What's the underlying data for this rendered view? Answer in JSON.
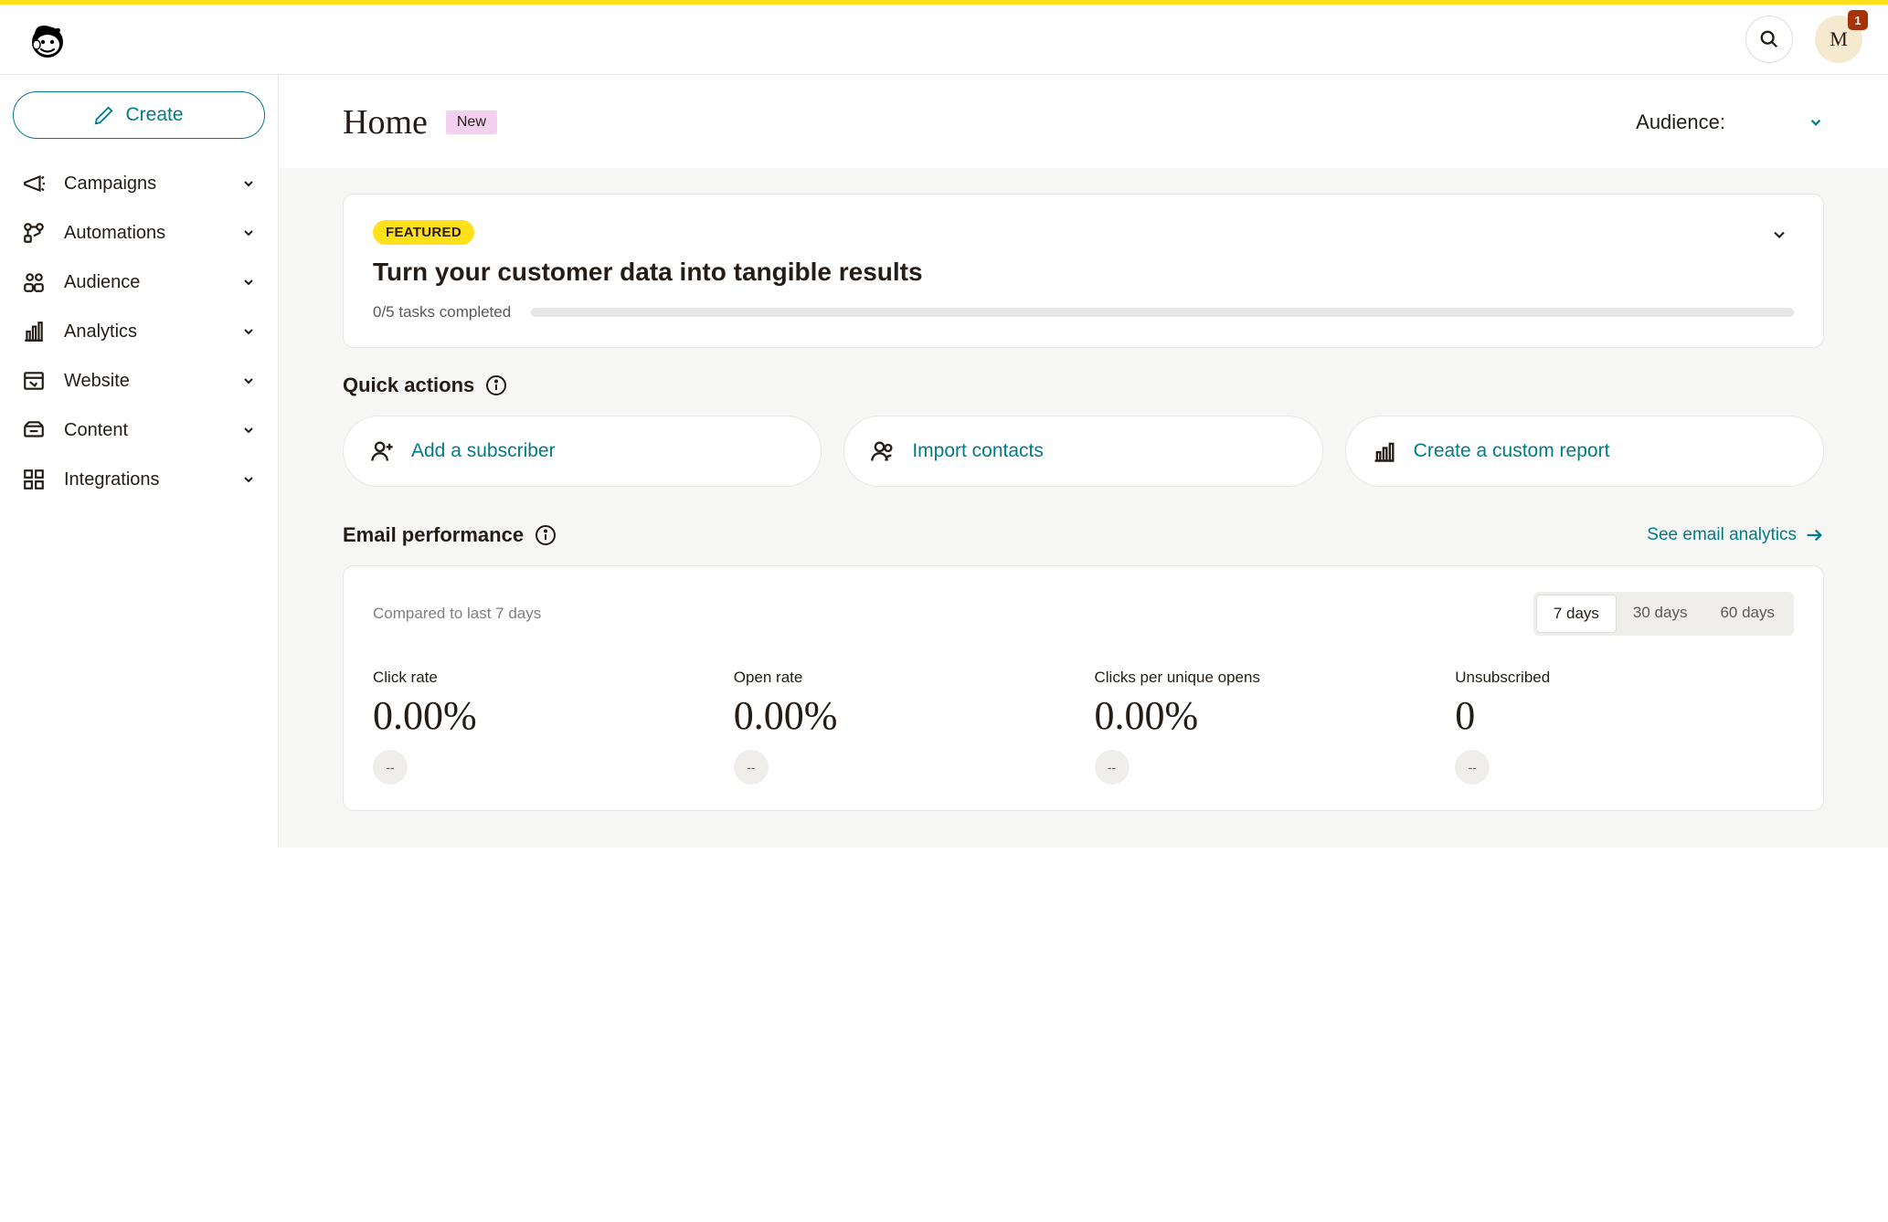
{
  "topbar": {
    "avatar_initial": "M",
    "notification_count": "1"
  },
  "sidebar": {
    "create_label": "Create",
    "items": [
      {
        "label": "Campaigns"
      },
      {
        "label": "Automations"
      },
      {
        "label": "Audience"
      },
      {
        "label": "Analytics"
      },
      {
        "label": "Website"
      },
      {
        "label": "Content"
      },
      {
        "label": "Integrations"
      }
    ]
  },
  "header": {
    "title": "Home",
    "new_badge": "New",
    "audience_label": "Audience:"
  },
  "featured": {
    "badge": "FEATURED",
    "title": "Turn your customer data into tangible results",
    "progress_text": "0/5 tasks completed"
  },
  "quick_actions": {
    "title": "Quick actions",
    "items": [
      {
        "label": "Add a subscriber"
      },
      {
        "label": "Import contacts"
      },
      {
        "label": "Create a custom report"
      }
    ]
  },
  "email_perf": {
    "title": "Email performance",
    "see_link": "See email analytics",
    "compared_text": "Compared to last 7 days",
    "range_tabs": [
      "7 days",
      "30 days",
      "60 days"
    ],
    "active_range": 0,
    "metrics": [
      {
        "label": "Click rate",
        "value": "0.00%",
        "change": "--"
      },
      {
        "label": "Open rate",
        "value": "0.00%",
        "change": "--"
      },
      {
        "label": "Clicks per unique opens",
        "value": "0.00%",
        "change": "--"
      },
      {
        "label": "Unsubscribed",
        "value": "0",
        "change": "--"
      }
    ]
  }
}
